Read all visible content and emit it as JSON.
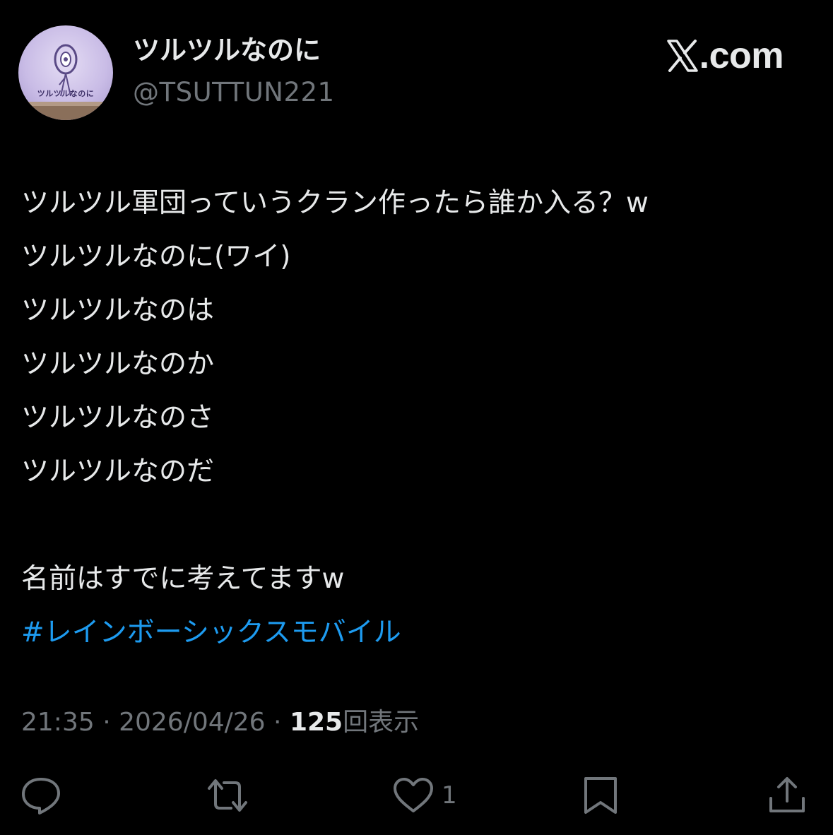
{
  "header": {
    "avatar_caption": "ツルツルなのに",
    "display_name": "ツルツルなのに",
    "handle": "@TSUTTUN221",
    "brand": ".com"
  },
  "tweet": {
    "lines": [
      "ツルツル軍団っていうクラン作ったら誰か入る？w",
      "ツルツルなのに(ワイ)",
      "ツルツルなのは",
      "ツルツルなのか",
      "ツルツルなのさ",
      "ツルツルなのだ",
      "",
      "名前はすでに考えてますw"
    ],
    "hashtag": "#レインボーシックスモバイル"
  },
  "meta": {
    "time": "21:35",
    "separator": " · ",
    "date": "2026/04/26",
    "views_count": "125",
    "views_label": "回表示"
  },
  "actions": {
    "like_count": "1"
  },
  "colors": {
    "background": "#000000",
    "text": "#e7e9ea",
    "secondary": "#71767b",
    "link": "#1d9bf0"
  }
}
